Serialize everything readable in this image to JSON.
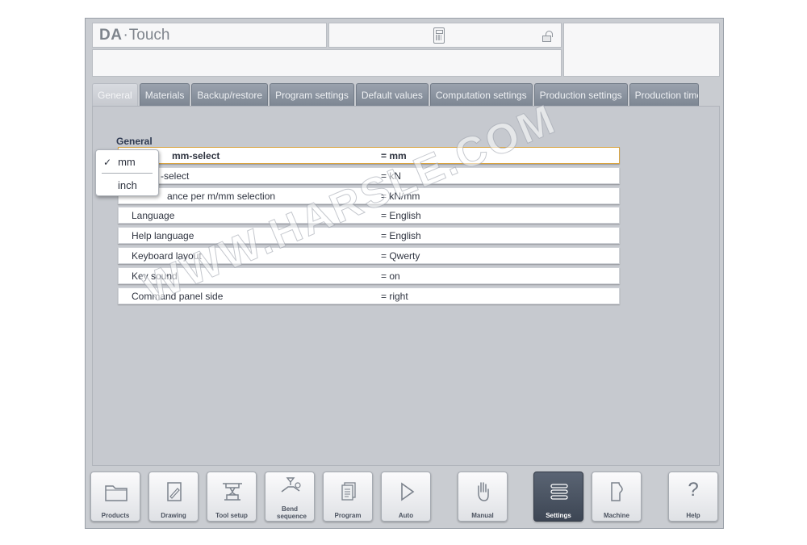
{
  "header": {
    "logo_da": "DA",
    "logo_dot": "·",
    "logo_touch": "Touch"
  },
  "tabs": [
    {
      "label": "General",
      "active": true
    },
    {
      "label": "Materials"
    },
    {
      "label": "Backup/restore"
    },
    {
      "label": "Program settings"
    },
    {
      "label": "Default values"
    },
    {
      "label": "Computation settings"
    },
    {
      "label": "Production settings"
    },
    {
      "label": "Production time"
    }
  ],
  "panel": {
    "group_title": "General",
    "rows": [
      {
        "label": "mm-select",
        "value": "= mm",
        "selected": true
      },
      {
        "label": "-select",
        "value": "= kN"
      },
      {
        "label": "ance per m/mm selection",
        "value": "= kN/mm"
      },
      {
        "label": "Language",
        "value": "= English"
      },
      {
        "label": "Help language",
        "value": "= English"
      },
      {
        "label": "Keyboard layout",
        "value": "= Qwerty"
      },
      {
        "label": "Key sound",
        "value": "= on"
      },
      {
        "label": "Command panel side",
        "value": "= right"
      }
    ]
  },
  "popup": {
    "check": "✓",
    "options": [
      {
        "label": "mm",
        "checked": true
      },
      {
        "label": "inch"
      }
    ]
  },
  "watermark": "WWW.HARSLE.COM",
  "bottom_buttons": [
    {
      "label": "Products",
      "icon": "folder-icon"
    },
    {
      "label": "Drawing",
      "icon": "drawing-icon"
    },
    {
      "label": "Tool setup",
      "icon": "tool-setup-icon"
    },
    {
      "label": "Bend sequence",
      "icon": "bend-sequence-icon"
    },
    {
      "label": "Program",
      "icon": "program-icon"
    },
    {
      "label": "Auto",
      "icon": "play-icon"
    },
    {
      "label": "Manual",
      "icon": "hand-icon"
    },
    {
      "label": "Settings",
      "icon": "settings-list-icon",
      "active": true
    },
    {
      "label": "Machine",
      "icon": "machine-icon"
    },
    {
      "label": "Help",
      "icon": "help-icon",
      "glyph": "?"
    }
  ]
}
